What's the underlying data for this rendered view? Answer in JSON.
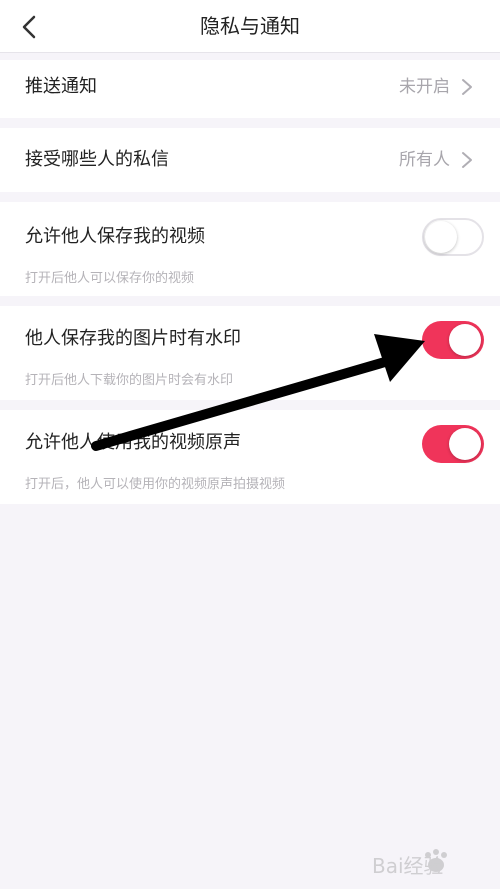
{
  "header": {
    "title": "隐私与通知",
    "back_icon": "chevron-left-icon"
  },
  "rows": [
    {
      "label": "推送通知",
      "value": "未开启"
    },
    {
      "label": "接受哪些人的私信",
      "value": "所有人"
    }
  ],
  "toggles": [
    {
      "label": "允许他人保存我的视频",
      "sub": "打开后他人可以保存你的视频",
      "on": false
    },
    {
      "label": "他人保存我的图片时有水印",
      "sub": "打开后他人下载你的图片时会有水印",
      "on": true
    },
    {
      "label": "允许他人使用我的视频原声",
      "sub": "打开后，他人可以使用你的视频原声拍摄视频",
      "on": true
    }
  ],
  "colors": {
    "accent": "#f0345a",
    "background": "#f6f4f9",
    "subtext": "#b5b3b8"
  },
  "annotation": {
    "type": "arrow",
    "color": "#000000",
    "icon": "arrow-annotation-icon"
  },
  "watermark": {
    "icon": "baidu-jingyan-watermark-icon",
    "text": "Bai经验"
  }
}
